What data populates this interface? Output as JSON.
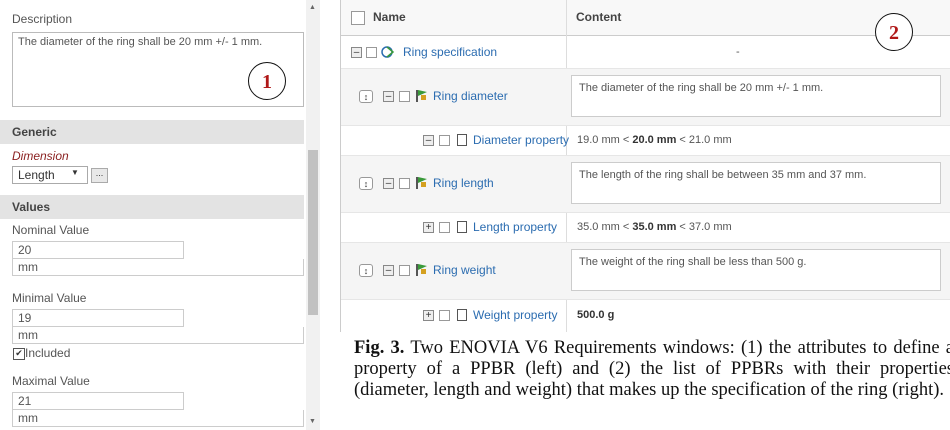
{
  "left_panel": {
    "description_label": "Description",
    "description_text": "The diameter of the ring shall be 20 mm +/- 1 mm.",
    "badge": "1",
    "generic_header": "Generic",
    "dimension_label": "Dimension",
    "dimension_value": "Length",
    "dimension_more": "...",
    "values_header": "Values",
    "nominal_label": "Nominal Value",
    "nominal_value": "20",
    "nominal_unit": "mm",
    "minimal_label": "Minimal Value",
    "minimal_value": "19",
    "minimal_unit": "mm",
    "included_label": "Included",
    "maximal_label": "Maximal Value",
    "maximal_value": "21",
    "maximal_unit": "mm"
  },
  "right_panel": {
    "col_name": "Name",
    "col_content": "Content",
    "badge": "2",
    "rows": [
      {
        "name": "Ring specification",
        "content": "-"
      },
      {
        "name": "Ring diameter",
        "content": "The diameter of the ring shall be 20 mm +/- 1 mm."
      },
      {
        "name": "Diameter property",
        "content_pre": "19.0 mm < ",
        "content_bold": "20.0 mm",
        "content_post": " < 21.0 mm"
      },
      {
        "name": "Ring length",
        "content": "The length of the ring shall be between 35 mm and 37 mm."
      },
      {
        "name": "Length property",
        "content_pre": "35.0 mm < ",
        "content_bold": "35.0 mm",
        "content_post": " < 37.0 mm"
      },
      {
        "name": "Ring weight",
        "content": "The weight of the ring shall be less than 500 g."
      },
      {
        "name": "Weight property",
        "content_bold": "500.0 g"
      }
    ]
  },
  "caption": {
    "fig": "Fig. 3.",
    "text": " Two ENOVIA V6 Requirements windows: (1) the attributes to define a property of a PPBR (left) and (2) the list of PPBRs with their properties (diameter, length and weight) that makes up the specification of the ring (right)."
  }
}
